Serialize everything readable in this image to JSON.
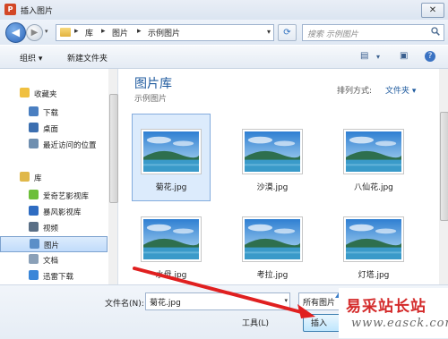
{
  "window": {
    "title": "插入图片",
    "close_glyph": "✕"
  },
  "address": {
    "crumbs": [
      "库",
      "图片",
      "示例图片"
    ],
    "sep": "▸",
    "search_placeholder": "搜索 示例图片"
  },
  "toolbar": {
    "organize": "组织 ▾",
    "new_folder": "新建文件夹"
  },
  "nav": {
    "items": [
      {
        "label": "收藏夹",
        "group": true,
        "color": "#f0c040"
      },
      {
        "label": "下载",
        "group": false,
        "color": "#4a7fc1"
      },
      {
        "label": "桌面",
        "group": false,
        "color": "#3c6fb0"
      },
      {
        "label": "最近访问的位置",
        "group": false,
        "color": "#6f8fb0"
      },
      {
        "label": "库",
        "group": true,
        "color": "#e0b84a"
      },
      {
        "label": "爱奇艺影视库",
        "group": false,
        "color": "#6cbf3a"
      },
      {
        "label": "暴风影视库",
        "group": false,
        "color": "#2e6cc2"
      },
      {
        "label": "视频",
        "group": false,
        "color": "#5a6f86"
      },
      {
        "label": "图片",
        "group": false,
        "color": "#5b8fc8",
        "selected": true
      },
      {
        "label": "文档",
        "group": false,
        "color": "#8aa0b8"
      },
      {
        "label": "迅雷下载",
        "group": false,
        "color": "#3a86d8"
      }
    ]
  },
  "content": {
    "library_title": "图片库",
    "library_sub": "示例图片",
    "arrange_label": "排列方式:",
    "arrange_value": "文件夹 ▾",
    "files": [
      {
        "name": "菊花.jpg",
        "selected": true
      },
      {
        "name": "沙漠.jpg"
      },
      {
        "name": "八仙花.jpg"
      },
      {
        "name": "水母.jpg"
      },
      {
        "name": "考拉.jpg"
      },
      {
        "name": "灯塔.jpg"
      }
    ]
  },
  "bottom": {
    "filename_label": "文件名(N):",
    "filename_value": "菊花.jpg",
    "filetype_value": "所有图片",
    "tools": "工具(L)",
    "insert": "插入"
  },
  "watermark": {
    "text": "易采站长站",
    "url": "www.easck.com"
  }
}
